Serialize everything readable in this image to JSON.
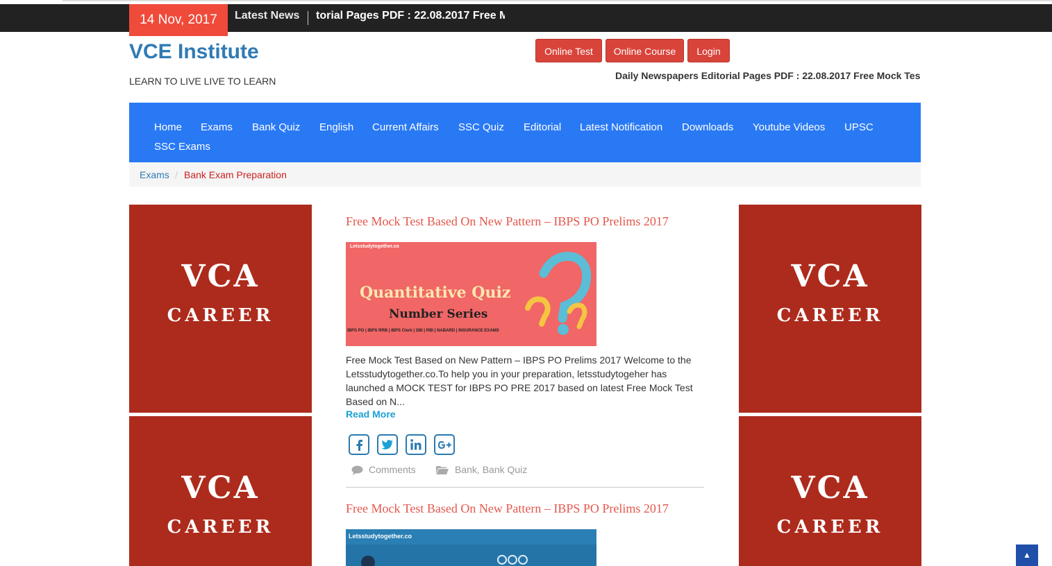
{
  "top_bar": {
    "date": "14 Nov, 2017",
    "latest_label": "Latest News",
    "ticker_text": "torial Pages PDF : 22.08.2017 Free M"
  },
  "header": {
    "site_title": "VCE Institute",
    "tagline": "LEARN TO LIVE LIVE TO LEARN",
    "buttons": [
      "Online Test",
      "Online Course",
      "Login"
    ],
    "news_line": "Daily Newspapers Editorial Pages PDF : 22.08.2017 Free Mock Tes"
  },
  "nav": {
    "items": [
      "Home",
      "Exams",
      "Bank Quiz",
      "English",
      "Current Affairs",
      "SSC Quiz",
      "Editorial",
      "Latest Notification",
      "Downloads",
      "Youtube Videos",
      "UPSC",
      "SSC Exams"
    ]
  },
  "breadcrumb": {
    "link": "Exams",
    "separator": "/",
    "active": "Bank Exam Preparation"
  },
  "ads": {
    "line1": "VCA",
    "line2": "CAREER"
  },
  "posts": [
    {
      "title": "Free Mock Test Based On New Pattern – IBPS PO Prelims 2017",
      "thumb_site": "Letsstudytogether.co",
      "thumb_title": "Quantitative Quiz",
      "thumb_subtitle": "Number Series",
      "thumb_strip": "IBPS PO | IBPS RRB | IBPS Clerk | SBI | RBI | NABARD | INSURANCE EXAMS",
      "excerpt": "Free Mock Test Based on New Pattern – IBPS PO Prelims 2017 Welcome to the Letsstudytogether.co.To help you in your preparation, letsstudytogeher has launched a MOCK TEST for IBPS PO PRE 2017 based on latest Free Mock Test Based on N...",
      "read_more": "Read More",
      "comments": "Comments",
      "categories": "Bank, Bank Quiz"
    },
    {
      "title": "Free Mock Test Based On New Pattern – IBPS PO Prelims 2017",
      "thumb_site": "Letsstudytogether.co"
    }
  ],
  "colors": {
    "accent_red": "#d9443a",
    "nav_blue": "#2979f5",
    "ad_red": "#ad2b1c",
    "title_blue": "#2f7ab4",
    "share_blue": "#2a7ab0"
  },
  "icons": [
    "facebook-icon",
    "twitter-icon",
    "linkedin-icon",
    "google-plus-icon",
    "comment-icon",
    "folder-icon",
    "chevron-up-icon"
  ]
}
